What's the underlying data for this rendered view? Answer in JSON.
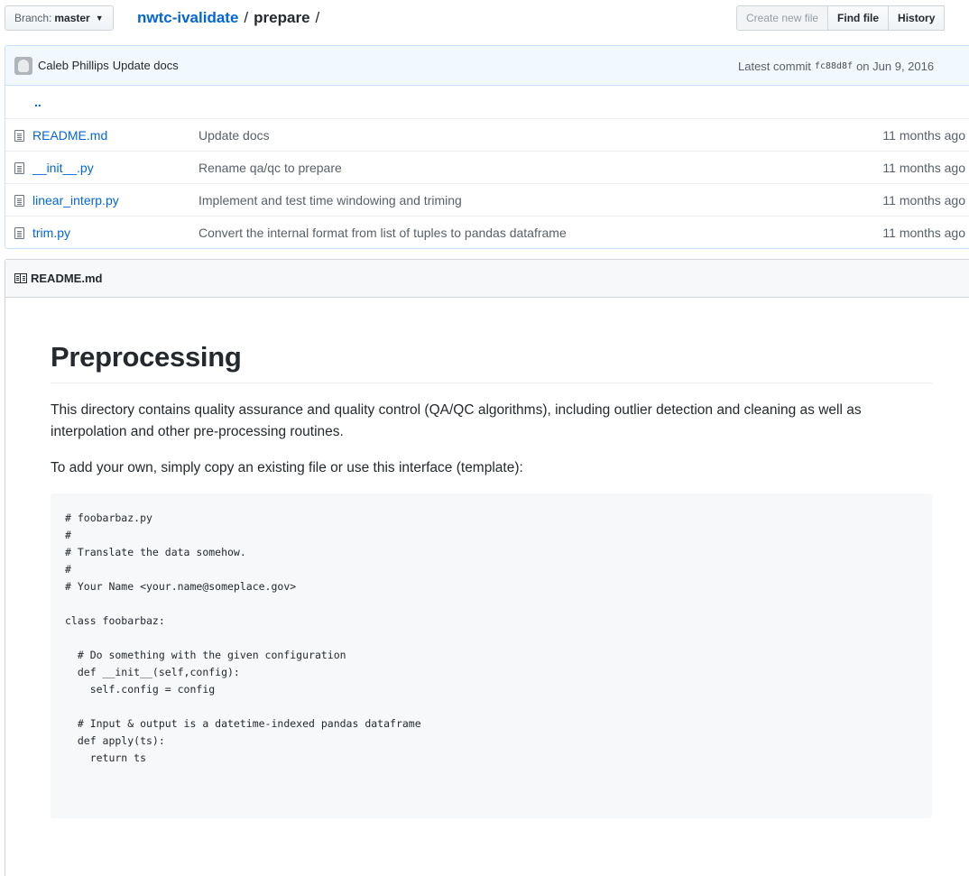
{
  "branch": {
    "label": "Branch:",
    "value": "master"
  },
  "breadcrumb": {
    "repo": "nwtc-ivalidate",
    "sep1": "/",
    "dir": "prepare",
    "sep2": "/"
  },
  "actions": {
    "create_new_file": "Create new file",
    "find_file": "Find file",
    "history": "History"
  },
  "commit": {
    "author": "Caleb Phillips",
    "message": "Update docs",
    "latest_label": "Latest commit",
    "sha": "fc88d8f",
    "date": "on Jun 9, 2016"
  },
  "parent_dir": "..",
  "files": [
    {
      "name": "README.md",
      "message": "Update docs",
      "age": "11 months ago",
      "icon": "file-text-icon"
    },
    {
      "name": "__init__.py",
      "message": "Rename qa/qc to prepare",
      "age": "11 months ago",
      "icon": "file-text-icon"
    },
    {
      "name": "linear_interp.py",
      "message": "Implement and test time windowing and triming",
      "age": "11 months ago",
      "icon": "file-text-icon"
    },
    {
      "name": "trim.py",
      "message": "Convert the internal format from list of tuples to pandas dataframe",
      "age": "11 months ago",
      "icon": "file-text-icon"
    }
  ],
  "readme": {
    "filename": "README.md",
    "icon": "book-icon",
    "title": "Preprocessing",
    "para1": "This directory contains quality assurance and quality control (QA/QC algorithms), including outlier detection and cleaning as well as interpolation and other pre-processing routines.",
    "para2": "To add your own, simply copy an existing file or use this interface (template):",
    "code": "# foobarbaz.py\n#\n# Translate the data somehow.\n#\n# Your Name <your.name@someplace.gov>\n\nclass foobarbaz:\n\n  # Do something with the given configuration\n  def __init__(self,config):\n    self.config = config\n\n  # Input & output is a datetime-indexed pandas dataframe\n  def apply(ts):\n    return ts"
  },
  "colors": {
    "link": "#0366d6",
    "commit_bar": "#f1f8ff",
    "muted": "#586069"
  }
}
